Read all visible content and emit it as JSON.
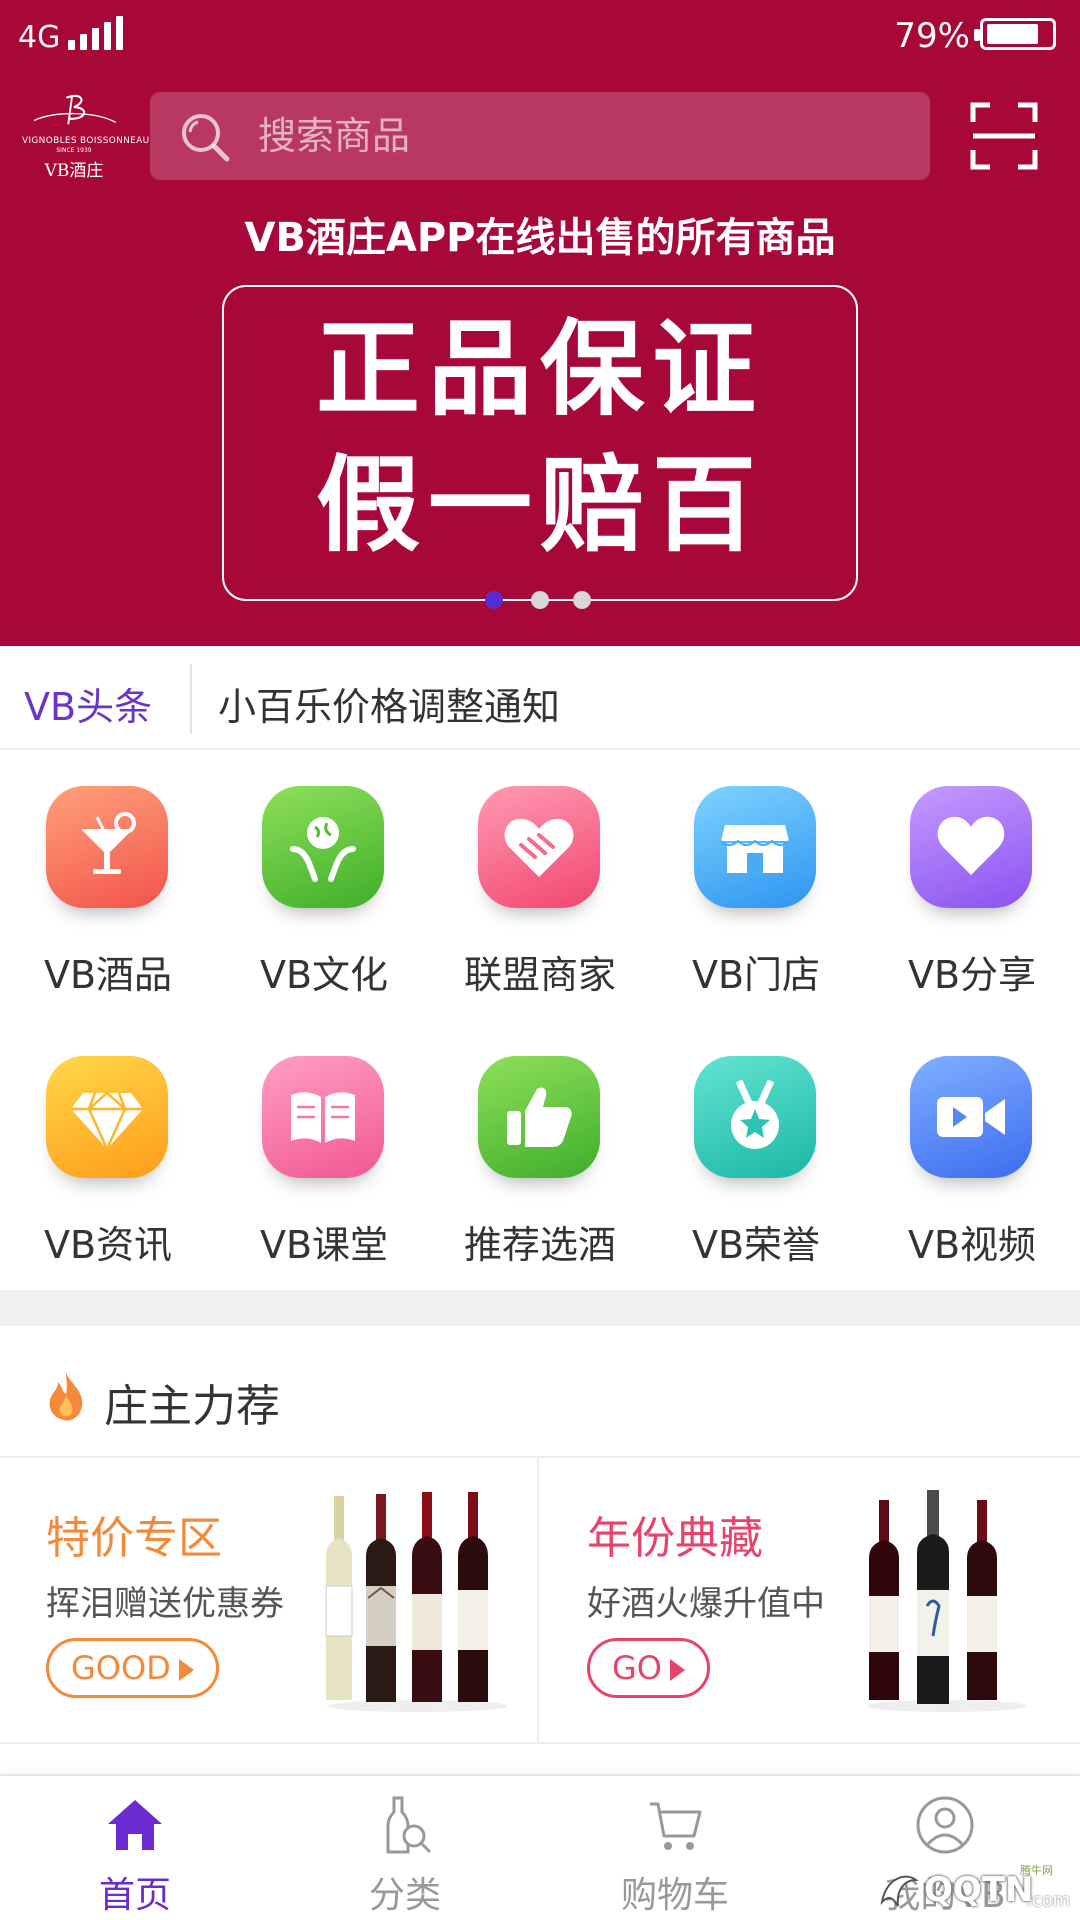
{
  "status_bar": {
    "network": "4G",
    "battery": "79%",
    "battery_level": 0.79
  },
  "header": {
    "logo": {
      "arc_text": "VIGNOBLES BOISSONNEAU",
      "since": "SINCE 1939",
      "name": "VB酒庄"
    },
    "search": {
      "placeholder": "搜索商品"
    }
  },
  "banner": {
    "caption": "VB酒庄APP在线出售的所有商品",
    "line1": "正品保证",
    "line2": "假一赔百",
    "page_count": 3,
    "active_page": 1
  },
  "headline": {
    "tag": "VB头条",
    "text": "小百乐价格调整通知"
  },
  "categories": [
    {
      "label": "VB酒品",
      "icon": "cocktail-icon",
      "colors": [
        "#ffa07a",
        "#f3544a"
      ]
    },
    {
      "label": "VB文化",
      "icon": "globe-hands-icon",
      "colors": [
        "#8fe05a",
        "#3fae2a"
      ]
    },
    {
      "label": "联盟商家",
      "icon": "heart-handshake-icon",
      "colors": [
        "#ff9bb2",
        "#f2466f"
      ]
    },
    {
      "label": "VB门店",
      "icon": "storefront-icon",
      "colors": [
        "#7fd3ff",
        "#2d95f0"
      ]
    },
    {
      "label": "VB分享",
      "icon": "heart-icon",
      "colors": [
        "#c59bff",
        "#8a52f0"
      ]
    },
    {
      "label": "VB资讯",
      "icon": "diamond-icon",
      "colors": [
        "#ffd84a",
        "#ff9c1a"
      ]
    },
    {
      "label": "VB课堂",
      "icon": "open-book-icon",
      "colors": [
        "#ff9fc4",
        "#f25793"
      ]
    },
    {
      "label": "推荐选酒",
      "icon": "thumbs-up-icon",
      "colors": [
        "#8fe05a",
        "#3fae2a"
      ]
    },
    {
      "label": "VB荣誉",
      "icon": "medal-icon",
      "colors": [
        "#63e4d2",
        "#1cb7a6"
      ]
    },
    {
      "label": "VB视频",
      "icon": "video-camera-icon",
      "colors": [
        "#7fb0ff",
        "#3d6cf0"
      ]
    }
  ],
  "recommend": {
    "title": "庄主力荐",
    "promos": [
      {
        "title": "特价专区",
        "subtitle": "挥泪赠送优惠券",
        "button": "GOOD",
        "color": "#f5893a"
      },
      {
        "title": "年份典藏",
        "subtitle": "好酒火爆升值中",
        "button": "GO",
        "color": "#e8436a"
      }
    ]
  },
  "bottom_nav": [
    {
      "label": "首页",
      "icon": "home-icon",
      "active": true
    },
    {
      "label": "分类",
      "icon": "bottle-search-icon",
      "active": false
    },
    {
      "label": "购物车",
      "icon": "cart-icon",
      "active": false
    },
    {
      "label": "我的VB",
      "icon": "user-circle-icon",
      "active": false
    }
  ],
  "watermark": {
    "text": "QQTN",
    "suffix": ".com",
    "small": "腾牛网"
  },
  "colors": {
    "brand": "#a8073a",
    "accent": "#6a2bd0",
    "headline_tag": "#6a34c8"
  }
}
